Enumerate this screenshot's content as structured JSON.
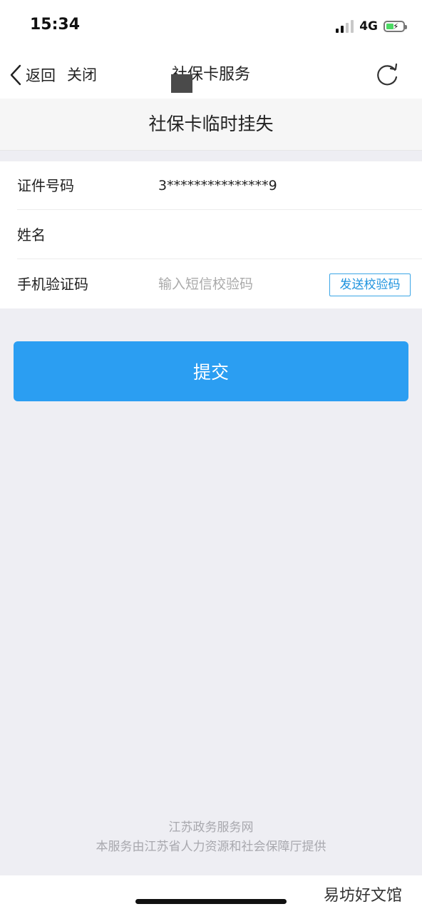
{
  "status_bar": {
    "time": "15:34",
    "network": "4G",
    "signal_bars_active": 2,
    "signal_bars_total": 4
  },
  "nav": {
    "back_label": "返回",
    "close_label": "关闭",
    "title": "社保卡服务"
  },
  "page": {
    "header": "社保卡临时挂失"
  },
  "form": {
    "id_number_label": "证件号码",
    "id_number_value": "3***************9",
    "name_label": "姓名",
    "sms_code_label": "手机验证码",
    "sms_code_placeholder": "输入短信校验码",
    "sms_code_value": "",
    "send_code_button": "发送校验码"
  },
  "submit_label": "提交",
  "footer": {
    "line1": "江苏政务服务网",
    "line2": "本服务由江苏省人力资源和社会保障厅提供"
  },
  "watermark": "易坊好文馆",
  "colors": {
    "accent": "#2b9ef2",
    "page_background": "#eeeef3",
    "footer_text": "#a8a8ae"
  }
}
